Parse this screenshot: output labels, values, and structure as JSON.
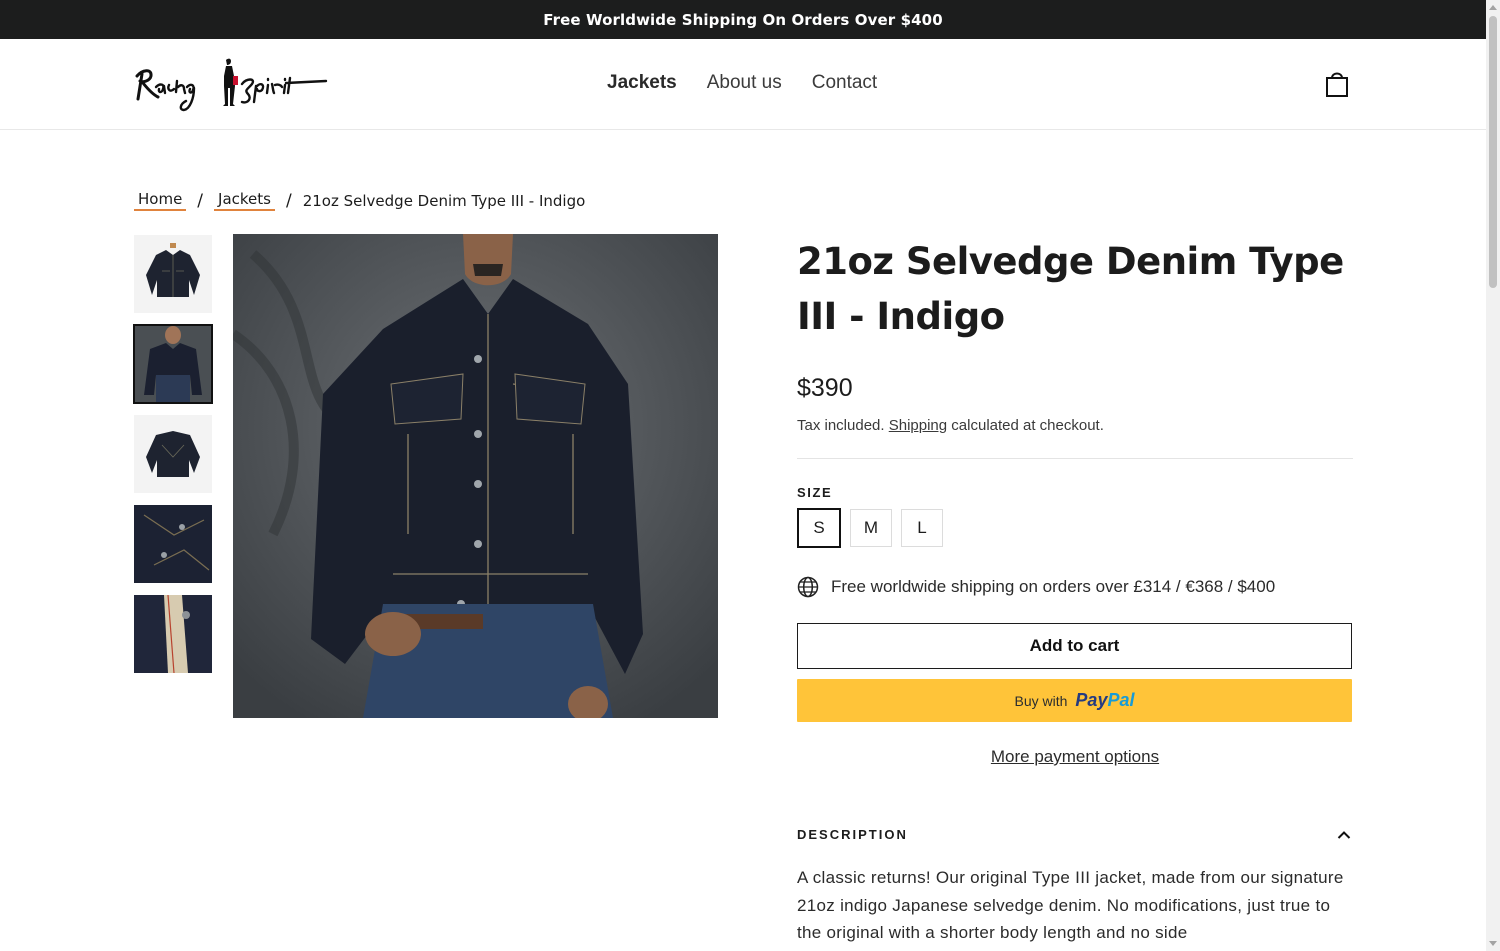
{
  "announcement": "Free Worldwide Shipping On Orders Over $400",
  "header": {
    "logo_alt": "Racing Spirit",
    "nav": [
      {
        "label": "Jackets"
      },
      {
        "label": "About us"
      },
      {
        "label": "Contact"
      }
    ],
    "cart_icon": "shopping-bag-icon"
  },
  "breadcrumb": {
    "home": "Home",
    "category": "Jackets",
    "sep": "/",
    "current": "21oz Selvedge Denim Type III - Indigo"
  },
  "gallery": {
    "thumbnails": [
      "jacket-front-flat",
      "jacket-worn-model",
      "jacket-back-flat",
      "fabric-detail",
      "selvedge-detail"
    ],
    "selected_index": 1
  },
  "product": {
    "title": "21oz Selvedge Denim Type III - Indigo",
    "price": "$390",
    "tax_prefix": "Tax included.",
    "tax_link": "Shipping",
    "tax_suffix": "calculated at checkout.",
    "size_label": "SIZE",
    "sizes": [
      "S",
      "M",
      "L"
    ],
    "selected_size": "S",
    "shipping_note": "Free worldwide shipping on orders over £314 / €368 / $400",
    "add_to_cart": "Add to cart",
    "paypal_prefix": "Buy with",
    "paypal_brand_1": "Pay",
    "paypal_brand_2": "Pal",
    "more_payment": "More payment options",
    "description_label": "DESCRIPTION",
    "description": "A classic returns! Our original Type III jacket, made from our signature 21oz indigo Japanese selvedge denim. No modifications, just true to the original with a shorter body length and no side"
  },
  "colors": {
    "accent_underline": "#e0833d",
    "paypal_yellow": "#ffc439",
    "announcement_bg": "#1c1d1d"
  }
}
